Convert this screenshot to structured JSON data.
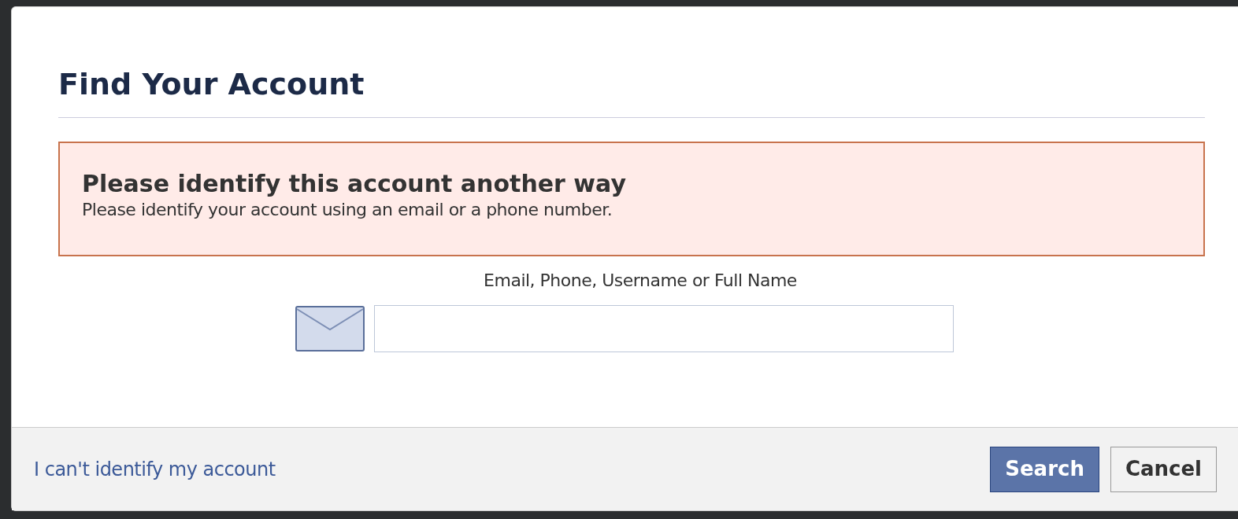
{
  "dialog": {
    "title": "Find Your Account",
    "alert": {
      "heading": "Please identify this account another way",
      "message": "Please identify your account using an email or a phone number."
    },
    "field": {
      "label": "Email, Phone, Username or Full Name"
    },
    "footer": {
      "link": "I can't identify my account",
      "buttons": [
        {
          "label": "Search",
          "kind": "primary"
        },
        {
          "label": "Cancel",
          "kind": "secondary"
        }
      ]
    }
  }
}
